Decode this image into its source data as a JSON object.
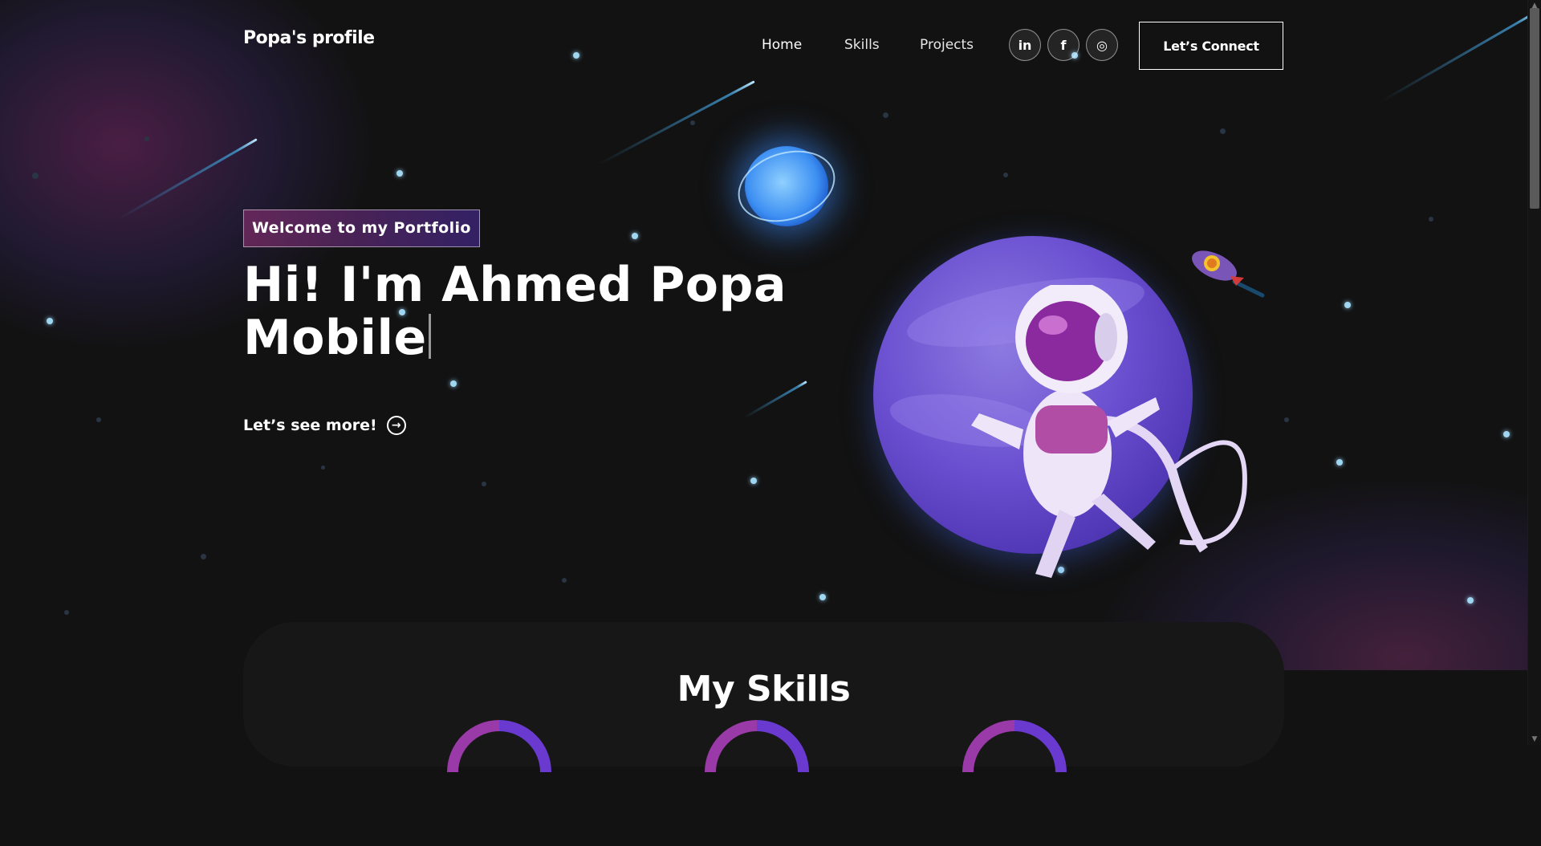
{
  "nav": {
    "logo": "Popa's profile",
    "links": [
      "Home",
      "Skills",
      "Projects"
    ],
    "social": [
      {
        "name": "linkedin-icon",
        "glyph": "in"
      },
      {
        "name": "facebook-icon",
        "glyph": "f"
      },
      {
        "name": "instagram-icon",
        "glyph": "◎"
      }
    ],
    "connect_label": "Let’s Connect"
  },
  "hero": {
    "tagline": "Welcome to my Portfolio",
    "headline_line1": "Hi! I'm Ahmed Popa",
    "headline_line2": "Mobile",
    "cta_label": "Let’s see more!",
    "cta_icon": "→"
  },
  "skills": {
    "title": "My Skills"
  },
  "colors": {
    "background": "#121212",
    "accent_pink": "#AA367C",
    "accent_purple": "#4A2FBD",
    "star": "#9fd6f0"
  }
}
